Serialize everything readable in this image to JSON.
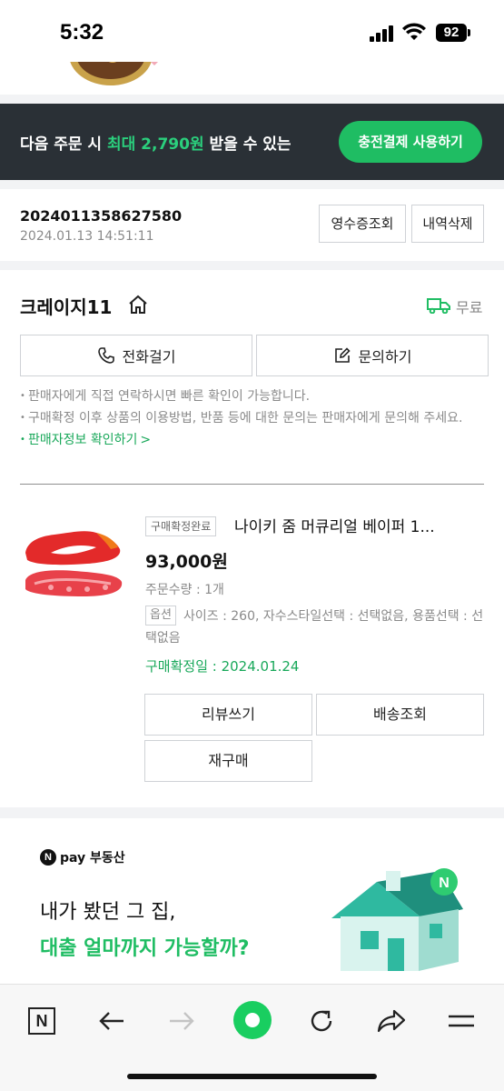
{
  "status_bar": {
    "time": "5:32",
    "battery": "92"
  },
  "promo": {
    "text_before": "다음 주문 시 ",
    "highlight": "최대 2,790원",
    "text_after": " 받을 수 있는",
    "button": "충전결제 사용하기",
    "accent_color": "#1fbd63"
  },
  "order": {
    "number": "2024011358627580",
    "datetime": "2024.01.13 14:51:11",
    "receipt_button": "영수증조회",
    "delete_button": "내역삭제"
  },
  "seller": {
    "name": "크레이지11",
    "shipping": "무료",
    "call_button": "전화걸기",
    "inquiry_button": "문의하기",
    "notes": [
      "판매자에게 직접 연락하시면 빠른 확인이 가능합니다.",
      "구매확정 이후 상품의 이용방법, 반품 등에 대한 문의는 판매자에게 문의해 주세요."
    ],
    "info_link": "판매자정보 확인하기",
    "info_link_arrow": ">"
  },
  "product": {
    "status": "구매확정완료",
    "title": "나이키 줌 머큐리얼 베이퍼 1...",
    "price": "93,000원",
    "quantity": "주문수량 : 1개",
    "option_label": "옵션",
    "option_text": "사이즈 : 260, 자수스타일선택 : 선택없음, 용품선택 : 선택없음",
    "confirm_date": "구매확정일 : 2024.01.24",
    "review_button": "리뷰쓰기",
    "shipping_button": "배송조회",
    "rebuy_button": "재구매"
  },
  "ad": {
    "brand_mark": "N",
    "brand": "pay 부동산",
    "line1": "내가 봤던 그 집,",
    "line2": "대출 얼마까지 가능할까?",
    "house_badge": "N"
  },
  "toolbar": {
    "home_label": "N",
    "icons": [
      "naver-home-icon",
      "back-arrow-icon",
      "forward-arrow-icon",
      "green-dot-icon",
      "refresh-icon",
      "share-icon",
      "menu-icon"
    ]
  }
}
